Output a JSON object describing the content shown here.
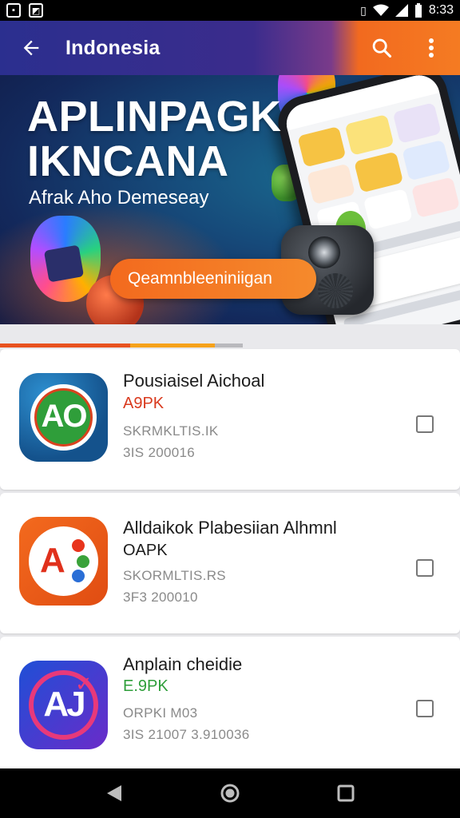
{
  "status_bar": {
    "time": "8:33",
    "left_icons": [
      "gallery-icon",
      "app-notification-icon"
    ],
    "right_icons": [
      "vibrate-icon",
      "wifi-icon",
      "signal-icon",
      "battery-icon"
    ]
  },
  "toolbar": {
    "title": "Indonesia",
    "back_icon": "arrow-left-icon",
    "search_icon": "search-icon",
    "menu_icon": "more-vert-icon",
    "colors": {
      "start": "#2b2f8f",
      "end": "#f57b22"
    }
  },
  "hero": {
    "title_line1": "APLINPAGK",
    "title_line2": "IKNCANA",
    "subtitle": "Afrak Aho Demeseay",
    "cta_label": "Qeamnbleeniniigan",
    "accent": "#f36a1e"
  },
  "progress": {
    "segment1_fraction": 0.535,
    "segment2_fraction": 0.35,
    "color1": "#e8521f",
    "color2": "#f6a21a"
  },
  "apps": [
    {
      "name": "Pousiaisel Aichoal",
      "tag": "A9PK",
      "tag_color": "#d93a1e",
      "meta1": "SKRMKLTIS.IK",
      "meta2": "3IS 200016",
      "icon": "ao-app-icon",
      "checked": false
    },
    {
      "name": "Alldaikok Plabesiian Alhmnl",
      "tag": "OAPK",
      "tag_color": "#1c1c1c",
      "meta1": "SKORMLTIS.RS",
      "meta2": "3F3 200010",
      "icon": "a-dots-app-icon",
      "checked": false
    },
    {
      "name": "Anplain cheidie",
      "tag": "E.9PK",
      "tag_color": "#2e9e3a",
      "meta1": "ORPKI M03",
      "meta2": "3IS 21007 3.910036",
      "icon": "aj-app-icon",
      "checked": false
    }
  ],
  "nav_bar": {
    "back_icon": "nav-back-icon",
    "home_icon": "nav-home-icon",
    "recents_icon": "nav-recents-icon"
  }
}
